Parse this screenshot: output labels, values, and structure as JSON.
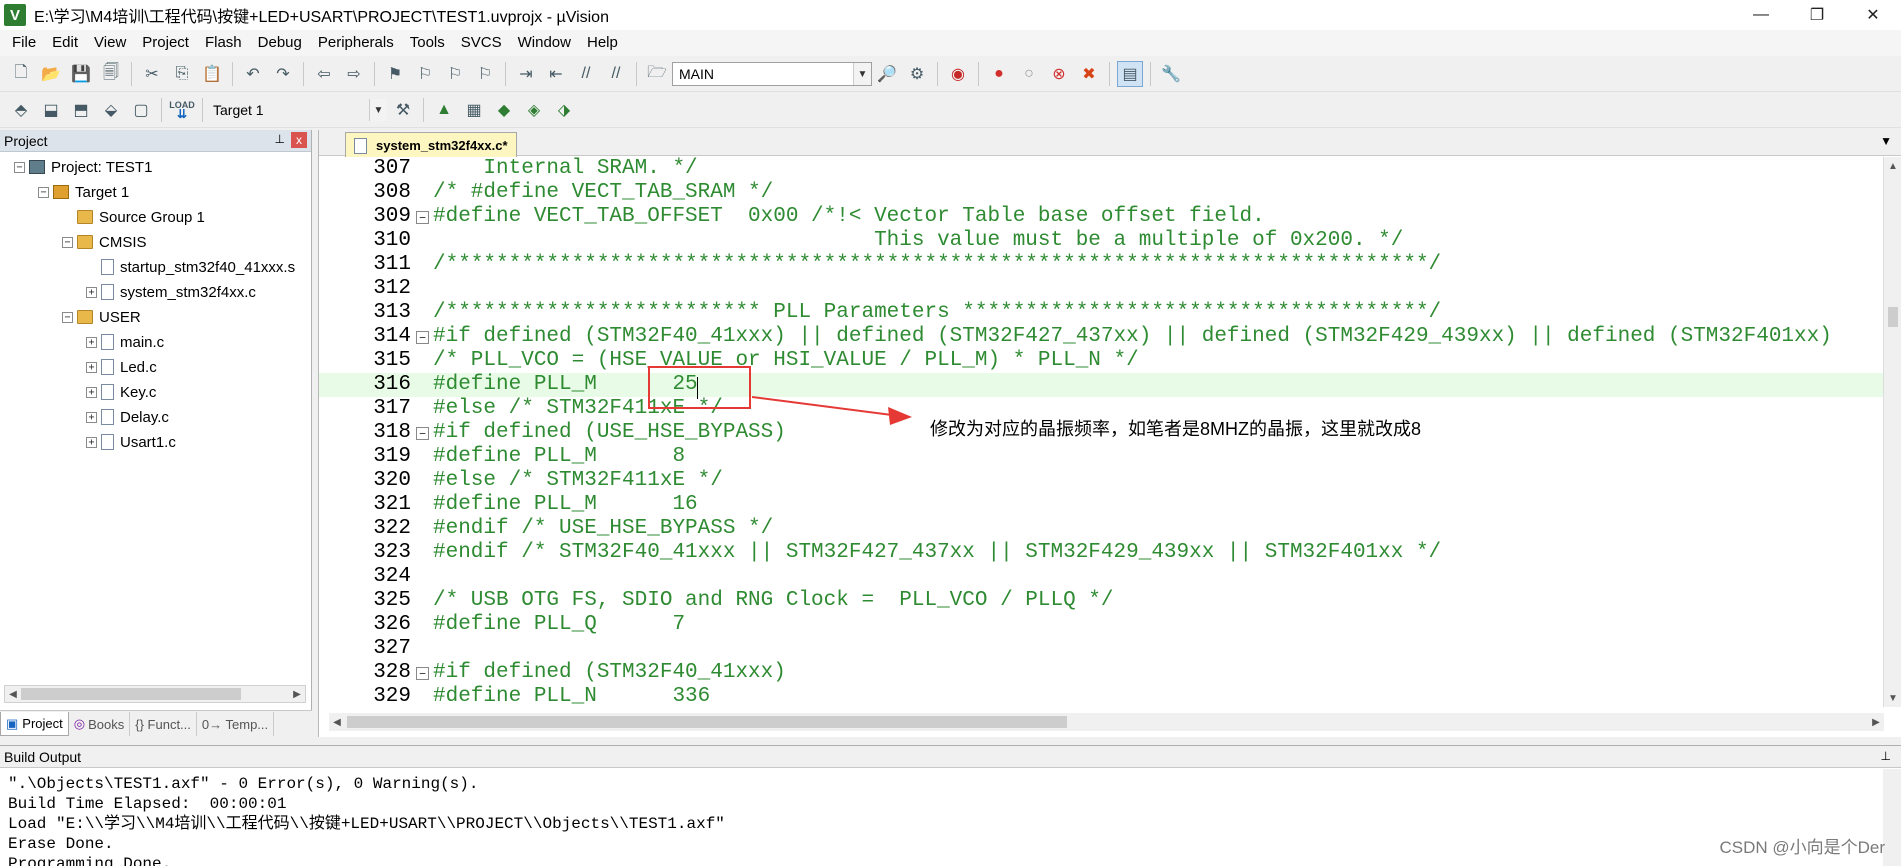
{
  "window": {
    "title": "E:\\学习\\M4培训\\工程代码\\按键+LED+USART\\PROJECT\\TEST1.uvprojx - µVision",
    "app_icon": "V",
    "minimize": "—",
    "maximize": "❐",
    "close": "✕"
  },
  "menu": [
    "File",
    "Edit",
    "View",
    "Project",
    "Flash",
    "Debug",
    "Peripherals",
    "Tools",
    "SVCS",
    "Window",
    "Help"
  ],
  "toolbar1": {
    "find_combo_value": "MAIN"
  },
  "toolbar2": {
    "load_label": "LOAD",
    "target_combo_value": "Target 1"
  },
  "project_panel": {
    "title": "Project",
    "pin": "⊥",
    "close": "x",
    "tree": [
      {
        "label": "Project: TEST1",
        "expander": "−",
        "icon": "project-icon"
      },
      {
        "label": "Target 1",
        "expander": "−",
        "icon": "target-icon"
      },
      {
        "label": "Source Group 1",
        "expander": "",
        "icon": "folder-icon"
      },
      {
        "label": "CMSIS",
        "expander": "−",
        "icon": "folder-icon"
      },
      {
        "label": "startup_stm32f40_41xxx.s",
        "expander": "",
        "icon": "file-icon"
      },
      {
        "label": "system_stm32f4xx.c",
        "expander": "+",
        "icon": "file-icon"
      },
      {
        "label": "USER",
        "expander": "−",
        "icon": "folder-icon"
      },
      {
        "label": "main.c",
        "expander": "+",
        "icon": "file-icon"
      },
      {
        "label": "Led.c",
        "expander": "+",
        "icon": "file-icon"
      },
      {
        "label": "Key.c",
        "expander": "+",
        "icon": "file-icon"
      },
      {
        "label": "Delay.c",
        "expander": "+",
        "icon": "file-icon"
      },
      {
        "label": "Usart1.c",
        "expander": "+",
        "icon": "file-icon"
      }
    ],
    "tabs": [
      "Project",
      "Books",
      "{} Funct...",
      "0→ Temp..."
    ]
  },
  "editor": {
    "tab_label": "system_stm32f4xx.c*",
    "tab_menu": "▼",
    "lines": [
      {
        "n": "307",
        "fold": "",
        "text": "    Internal SRAM. */",
        "hl": false
      },
      {
        "n": "308",
        "fold": "",
        "text": "/* #define VECT_TAB_SRAM */",
        "hl": false
      },
      {
        "n": "309",
        "fold": "−",
        "text": "#define VECT_TAB_OFFSET  0x00 /*!< Vector Table base offset field.",
        "hl": false
      },
      {
        "n": "310",
        "fold": "",
        "text": "                                   This value must be a multiple of 0x200. */",
        "hl": false
      },
      {
        "n": "311",
        "fold": "",
        "text": "/******************************************************************************/",
        "hl": false
      },
      {
        "n": "312",
        "fold": "",
        "text": "",
        "hl": false
      },
      {
        "n": "313",
        "fold": "",
        "text": "/************************* PLL Parameters *************************************/",
        "hl": false
      },
      {
        "n": "314",
        "fold": "−",
        "text": "#if defined (STM32F40_41xxx) || defined (STM32F427_437xx) || defined (STM32F429_439xx) || defined (STM32F401xx)",
        "hl": false
      },
      {
        "n": "315",
        "fold": "",
        "text": "/* PLL_VCO = (HSE_VALUE or HSI_VALUE / PLL_M) * PLL_N */",
        "hl": false
      },
      {
        "n": "316",
        "fold": "",
        "text": "#define PLL_M      25",
        "hl": true
      },
      {
        "n": "317",
        "fold": "",
        "text": "#else /* STM32F411xE */",
        "hl": false
      },
      {
        "n": "318",
        "fold": "−",
        "text": "#if defined (USE_HSE_BYPASS)",
        "hl": false
      },
      {
        "n": "319",
        "fold": "",
        "text": "#define PLL_M      8",
        "hl": false
      },
      {
        "n": "320",
        "fold": "",
        "text": "#else /* STM32F411xE */",
        "hl": false
      },
      {
        "n": "321",
        "fold": "",
        "text": "#define PLL_M      16",
        "hl": false
      },
      {
        "n": "322",
        "fold": "",
        "text": "#endif /* USE_HSE_BYPASS */",
        "hl": false
      },
      {
        "n": "323",
        "fold": "",
        "text": "#endif /* STM32F40_41xxx || STM32F427_437xx || STM32F429_439xx || STM32F401xx */",
        "hl": false
      },
      {
        "n": "324",
        "fold": "",
        "text": "",
        "hl": false
      },
      {
        "n": "325",
        "fold": "",
        "text": "/* USB OTG FS, SDIO and RNG Clock =  PLL_VCO / PLLQ */",
        "hl": false
      },
      {
        "n": "326",
        "fold": "",
        "text": "#define PLL_Q      7",
        "hl": false
      },
      {
        "n": "327",
        "fold": "",
        "text": "",
        "hl": false
      },
      {
        "n": "328",
        "fold": "−",
        "text": "#if defined (STM32F40_41xxx)",
        "hl": false
      },
      {
        "n": "329",
        "fold": "",
        "text": "#define PLL_N      336",
        "hl": false
      }
    ]
  },
  "annotation": {
    "text": "修改为对应的晶振频率，如笔者是8MHZ的晶振，这里就改成8",
    "color": "#e53935"
  },
  "build_output": {
    "title": "Build Output",
    "pin": "⊥",
    "lines": [
      "\".\\Objects\\TEST1.axf\" - 0 Error(s), 0 Warning(s).",
      "Build Time Elapsed:  00:00:01",
      "Load \"E:\\\\学习\\\\M4培训\\\\工程代码\\\\按键+LED+USART\\\\PROJECT\\\\Objects\\\\TEST1.axf\"",
      "Erase Done.",
      "Programming Done."
    ]
  },
  "watermark": "CSDN @小向是个Der"
}
